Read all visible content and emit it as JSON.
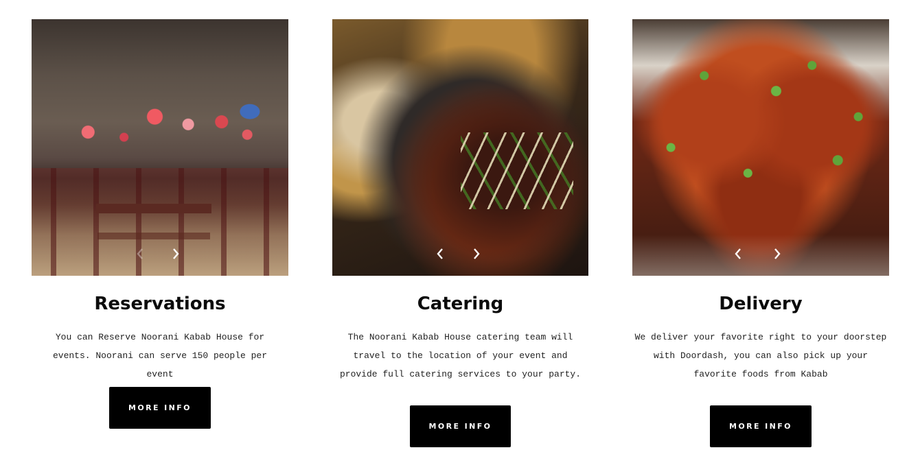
{
  "cards": [
    {
      "title": "Reservations",
      "description": "You can Reserve Noorani Kabab House for events. Noorani can serve 150 people per event",
      "button_label": "MORE INFO",
      "image": "restaurant-dining-room-photo"
    },
    {
      "title": "Catering",
      "description": "The Noorani Kabab House catering team will travel to the location of your event and provide full catering services to your party.",
      "button_label": "MORE INFO",
      "image": "curry-dish-photo"
    },
    {
      "title": "Delivery",
      "description": "We deliver your favorite right to your doorstep with Doordash, you can also pick up your favorite foods from Kabab",
      "button_label": "MORE INFO",
      "image": "chili-chicken-photo"
    }
  ],
  "slider_icons": {
    "prev": "chevron-left-icon",
    "next": "chevron-right-icon"
  },
  "colors": {
    "button_bg": "#000000",
    "button_text": "#ffffff",
    "heading": "#0b0b0b",
    "body_text": "#222222"
  }
}
